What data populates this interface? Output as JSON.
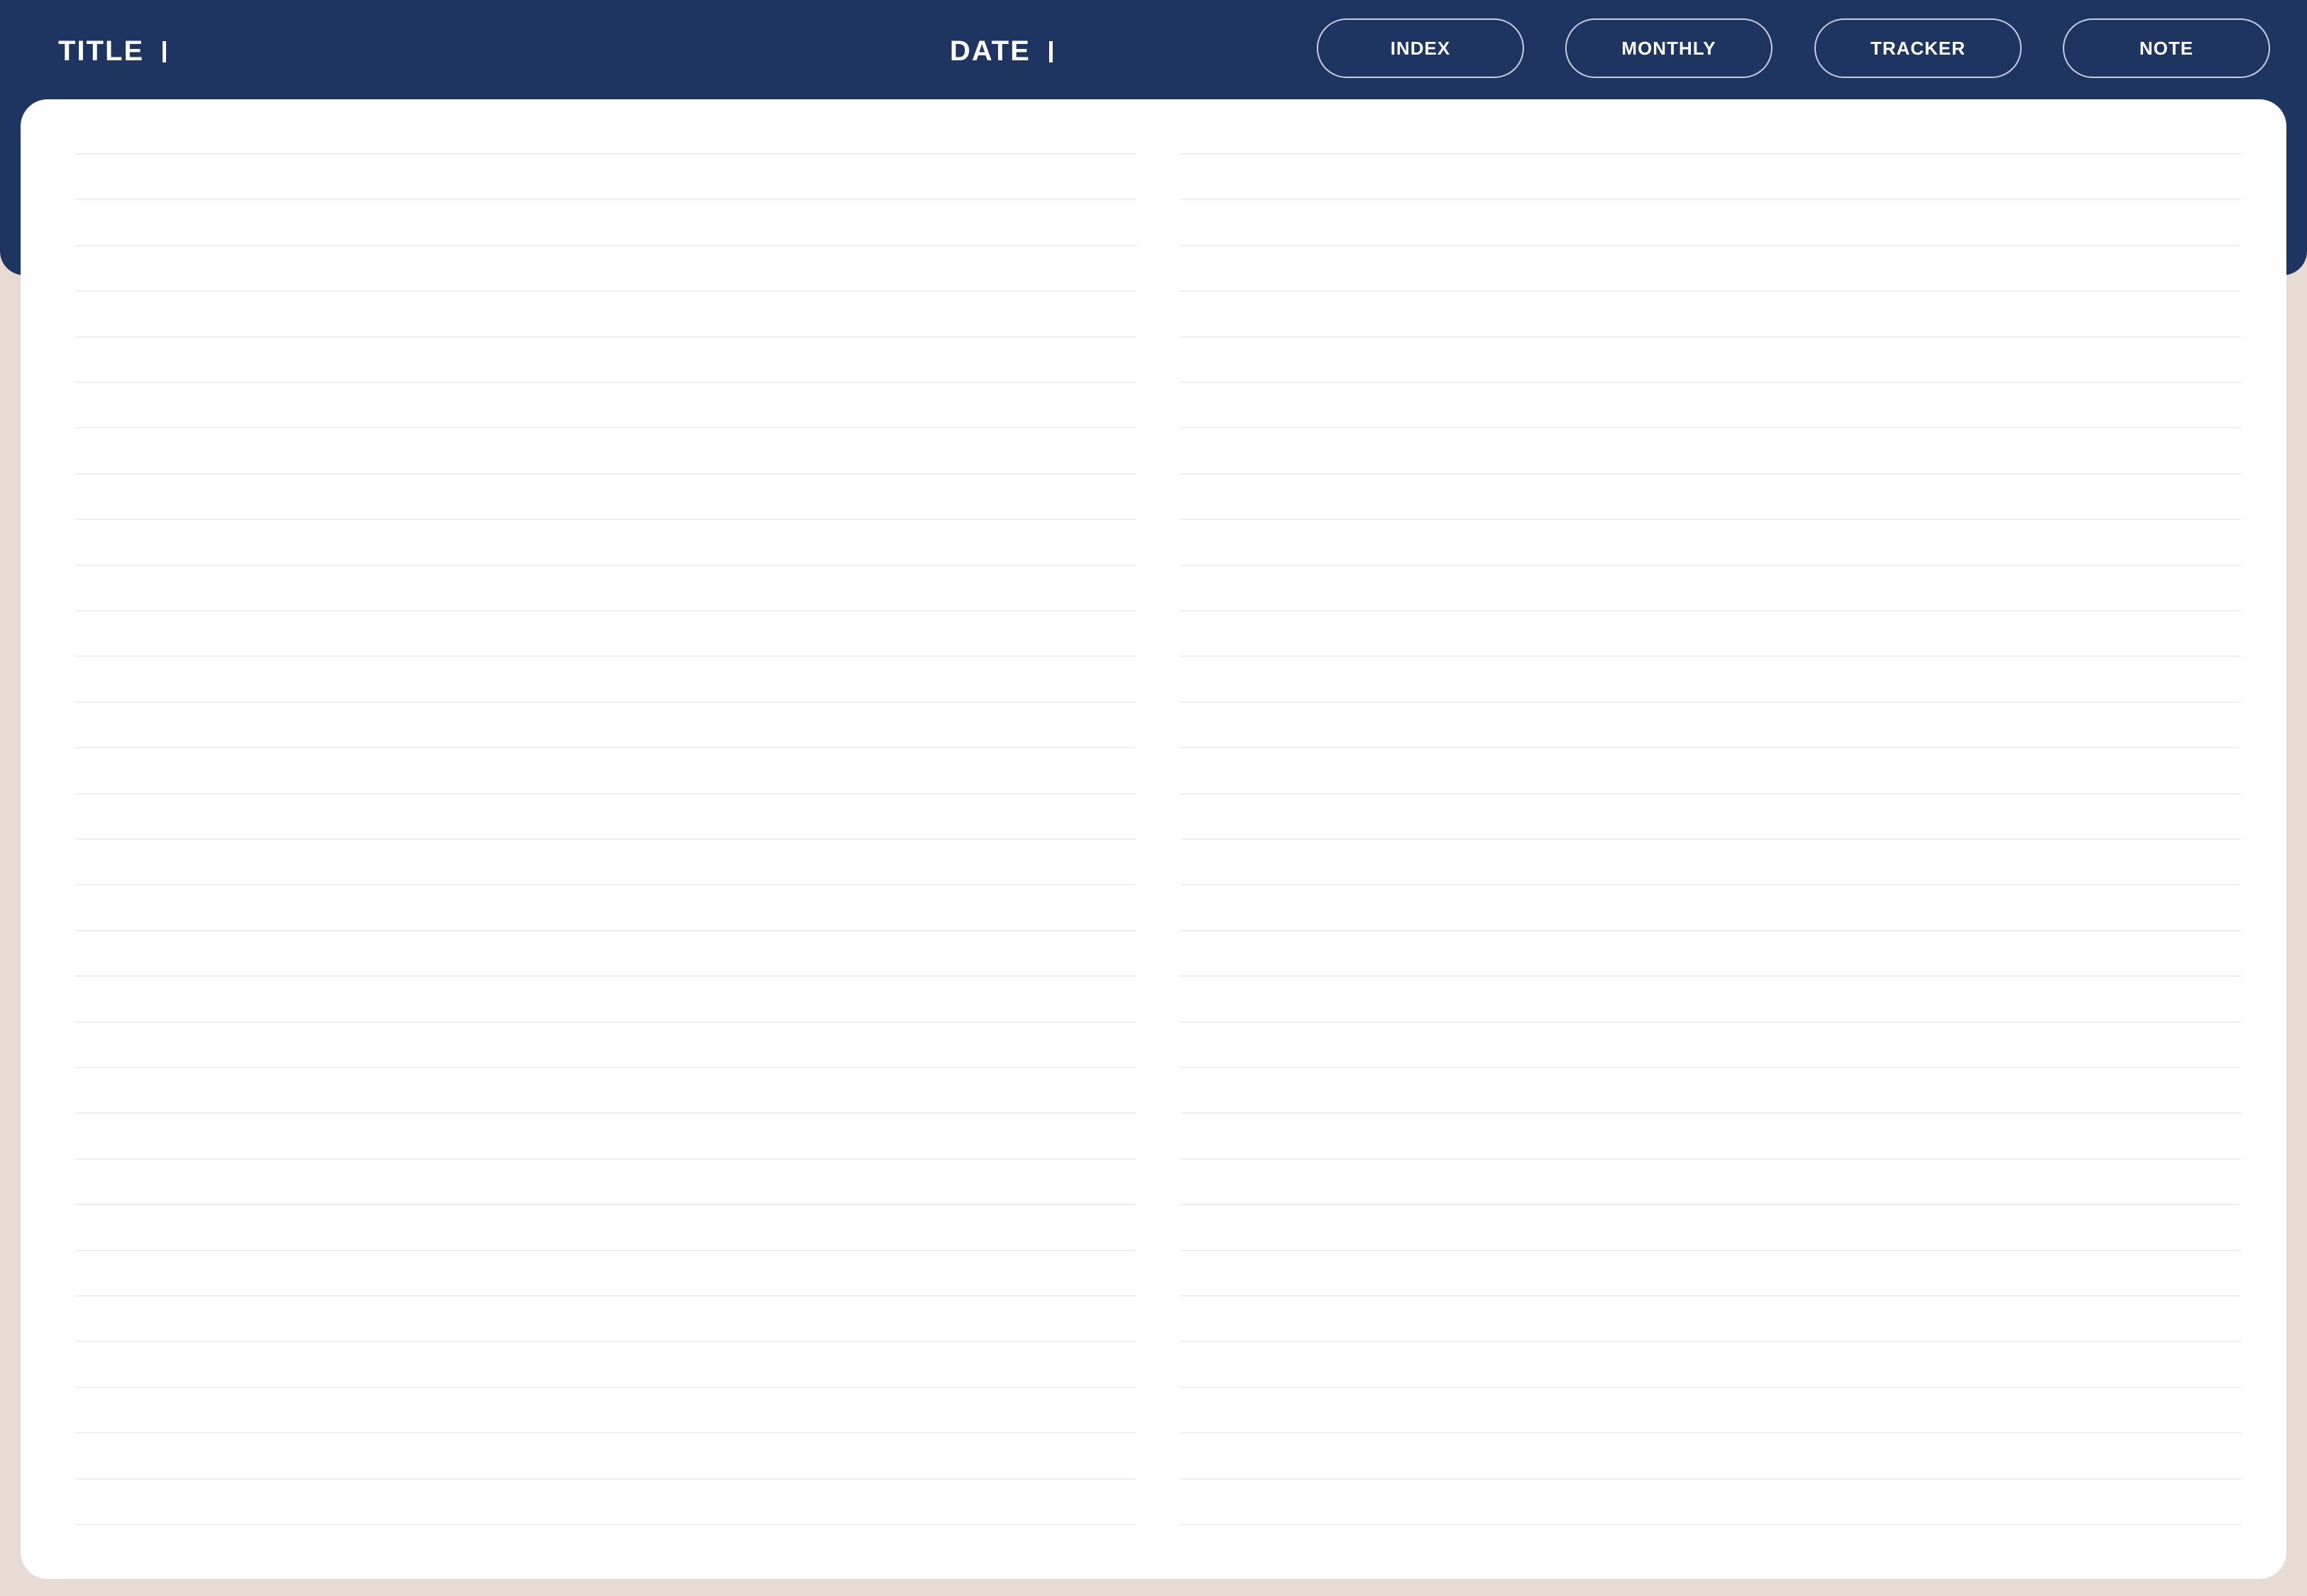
{
  "header": {
    "title_label": "TITLE",
    "date_label": "DATE"
  },
  "nav": {
    "index": "INDEX",
    "monthly": "MONTHLY",
    "tracker": "TRACKER",
    "note": "NOTE"
  },
  "colors": {
    "header_background": "#1e3461",
    "page_background": "#e8dbd3",
    "paper": "#ffffff",
    "rule_line": "#eceff2",
    "header_text": "#ffffff"
  },
  "notes": {
    "lines_per_column": 31,
    "columns": 2
  }
}
